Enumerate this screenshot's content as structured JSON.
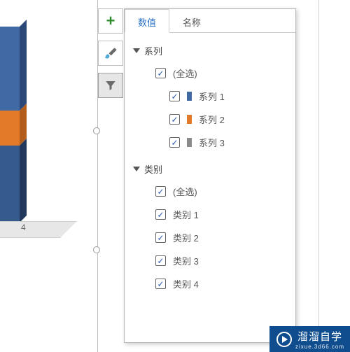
{
  "chart_data": {
    "type": "bar",
    "stacked": true,
    "categories": [
      "类别 1",
      "类别 2",
      "类别 3",
      "类别 4"
    ],
    "visible_category_index": 3,
    "series": [
      {
        "name": "系列 1",
        "color": "#4169a4"
      },
      {
        "name": "系列 2",
        "color": "#e37a2a"
      },
      {
        "name": "系列 3",
        "color": "#8a8a8a"
      }
    ],
    "axis_label_visible": "4"
  },
  "format_buttons": {
    "add": "+",
    "brush": "🖌",
    "filter": "▾"
  },
  "panel": {
    "tabs": {
      "values": "数值",
      "names": "名称",
      "active": "values"
    },
    "groups": {
      "series": {
        "label": "系列",
        "select_all": "(全选)",
        "items": [
          {
            "label": "系列 1",
            "color": "#4169a4",
            "checked": true
          },
          {
            "label": "系列 2",
            "color": "#e37a2a",
            "checked": true
          },
          {
            "label": "系列 3",
            "color": "#8a8a8a",
            "checked": true
          }
        ]
      },
      "categories": {
        "label": "类别",
        "select_all": "(全选)",
        "items": [
          {
            "label": "类别 1",
            "checked": true
          },
          {
            "label": "类别 2",
            "checked": true
          },
          {
            "label": "类别 3",
            "checked": true
          },
          {
            "label": "类别 4",
            "checked": true
          }
        ]
      }
    }
  },
  "badge": {
    "text": "溜溜自学",
    "sub": "zixue.3d66.com"
  }
}
